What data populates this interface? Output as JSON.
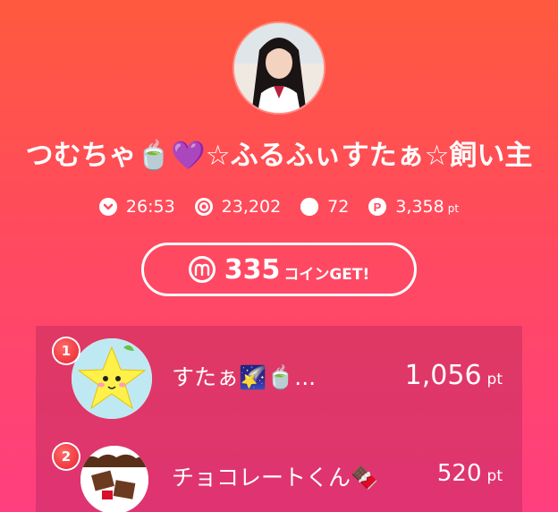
{
  "profile": {
    "name": "つむちゃ🍵💜☆ふるふぃすたぁ☆飼い主"
  },
  "stats": {
    "time": "26:53",
    "views": "23,202",
    "comments": "72",
    "points": "3,358",
    "points_unit": "pt"
  },
  "coin_button": {
    "count": "335",
    "suffix": "コインGET!"
  },
  "ranking": [
    {
      "rank": "1",
      "name": "すたぁ🌠🍵...",
      "score": "1,056",
      "unit": "pt"
    },
    {
      "rank": "2",
      "name": "チョコレートくん🍫",
      "score": "520",
      "unit": "pt"
    }
  ],
  "colors": {
    "gradient_top": "#ff5a3e",
    "gradient_bottom": "#ff3f7f",
    "badge": "#e8232e"
  }
}
